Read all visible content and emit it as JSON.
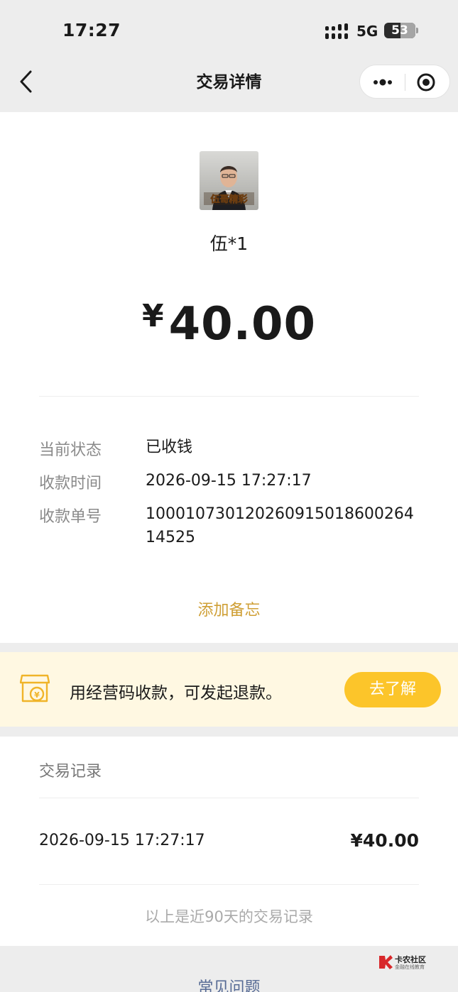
{
  "status_bar": {
    "time": "17:27",
    "network": "5G",
    "battery": "53",
    "battery_level": 0.53
  },
  "nav": {
    "title": "交易详情"
  },
  "payer": {
    "avatar_caption": "伍哥精彩",
    "name": "伍*1"
  },
  "amount": {
    "currency": "¥",
    "value": "40.00"
  },
  "details": [
    {
      "label": "当前状态",
      "value": "已收钱"
    },
    {
      "label": "收款时间",
      "value": "2026-09-15 17:27:17"
    },
    {
      "label": "收款单号",
      "value": "100010730120260915018600264145​25"
    }
  ],
  "add_memo": "添加备忘",
  "promo": {
    "text": "用经营码收款，可发起退款。",
    "button": "去了解"
  },
  "records": {
    "title": "交易记录",
    "items": [
      {
        "date": "2026-09-15 17:27:17",
        "amount": "¥40.00"
      }
    ],
    "note": "以上是近90天的交易记录"
  },
  "faq": "常见问题",
  "watermark": {
    "name": "卡农社区",
    "sub": "金融在线教育"
  },
  "colors": {
    "accent": "#cf9f35",
    "promo_bg": "#fff8e2",
    "promo_button": "#fcc52a",
    "link": "#576b95"
  }
}
